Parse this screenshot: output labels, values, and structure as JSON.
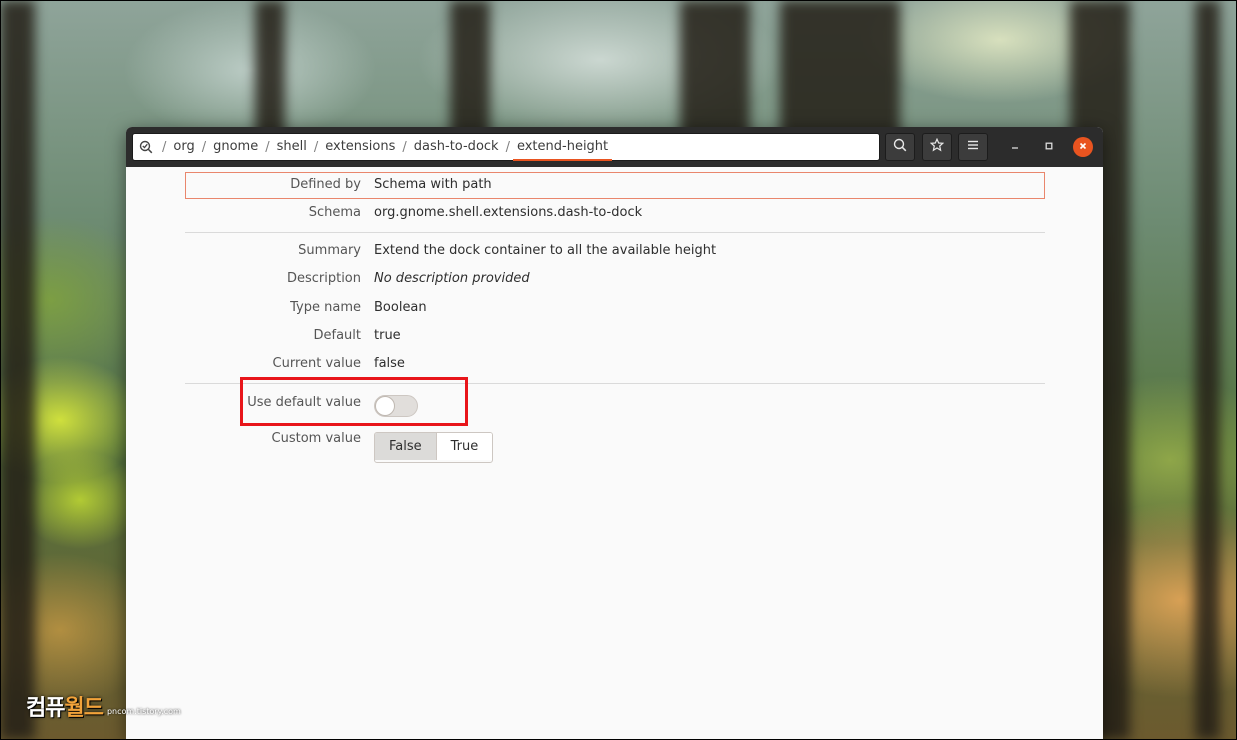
{
  "pathbar": {
    "crumbs": [
      "org",
      "gnome",
      "shell",
      "extensions",
      "dash-to-dock",
      "extend-height"
    ],
    "separator": "/"
  },
  "header_buttons": {
    "search_icon": "search-icon",
    "bookmark_icon": "star-icon",
    "menu_icon": "hamburger-menu-icon"
  },
  "window_controls": [
    "minimize",
    "maximize",
    "close"
  ],
  "details": {
    "defined_by": {
      "label": "Defined by",
      "value": "Schema with path"
    },
    "schema": {
      "label": "Schema",
      "value": "org.gnome.shell.extensions.dash-to-dock"
    },
    "summary": {
      "label": "Summary",
      "value": "Extend the dock container to all the available height"
    },
    "description": {
      "label": "Description",
      "value": "No description provided"
    },
    "type_name": {
      "label": "Type name",
      "value": "Boolean"
    },
    "default": {
      "label": "Default",
      "value": "true"
    },
    "current_value": {
      "label": "Current value",
      "value": "false"
    },
    "use_default": {
      "label": "Use default value",
      "enabled": false
    },
    "custom_value": {
      "label": "Custom value",
      "options": [
        "False",
        "True"
      ],
      "selected": "False"
    }
  },
  "colors": {
    "accent": "#e95420",
    "annotation_red": "#e8151a",
    "headerbar": "#2c2c2c"
  },
  "watermark": {
    "big_a": "컴퓨",
    "big_b": "월드",
    "small": "pncom.tistory.com"
  }
}
